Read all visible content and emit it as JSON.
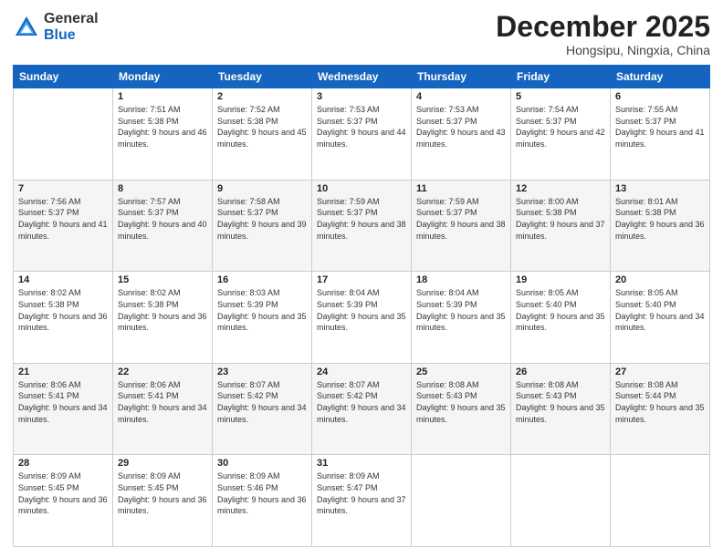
{
  "logo": {
    "general": "General",
    "blue": "Blue"
  },
  "header": {
    "month": "December 2025",
    "location": "Hongsipu, Ningxia, China"
  },
  "weekdays": [
    "Sunday",
    "Monday",
    "Tuesday",
    "Wednesday",
    "Thursday",
    "Friday",
    "Saturday"
  ],
  "weeks": [
    [
      {
        "day": "",
        "sunrise": "",
        "sunset": "",
        "daylight": ""
      },
      {
        "day": "1",
        "sunrise": "Sunrise: 7:51 AM",
        "sunset": "Sunset: 5:38 PM",
        "daylight": "Daylight: 9 hours and 46 minutes."
      },
      {
        "day": "2",
        "sunrise": "Sunrise: 7:52 AM",
        "sunset": "Sunset: 5:38 PM",
        "daylight": "Daylight: 9 hours and 45 minutes."
      },
      {
        "day": "3",
        "sunrise": "Sunrise: 7:53 AM",
        "sunset": "Sunset: 5:37 PM",
        "daylight": "Daylight: 9 hours and 44 minutes."
      },
      {
        "day": "4",
        "sunrise": "Sunrise: 7:53 AM",
        "sunset": "Sunset: 5:37 PM",
        "daylight": "Daylight: 9 hours and 43 minutes."
      },
      {
        "day": "5",
        "sunrise": "Sunrise: 7:54 AM",
        "sunset": "Sunset: 5:37 PM",
        "daylight": "Daylight: 9 hours and 42 minutes."
      },
      {
        "day": "6",
        "sunrise": "Sunrise: 7:55 AM",
        "sunset": "Sunset: 5:37 PM",
        "daylight": "Daylight: 9 hours and 41 minutes."
      }
    ],
    [
      {
        "day": "7",
        "sunrise": "Sunrise: 7:56 AM",
        "sunset": "Sunset: 5:37 PM",
        "daylight": "Daylight: 9 hours and 41 minutes."
      },
      {
        "day": "8",
        "sunrise": "Sunrise: 7:57 AM",
        "sunset": "Sunset: 5:37 PM",
        "daylight": "Daylight: 9 hours and 40 minutes."
      },
      {
        "day": "9",
        "sunrise": "Sunrise: 7:58 AM",
        "sunset": "Sunset: 5:37 PM",
        "daylight": "Daylight: 9 hours and 39 minutes."
      },
      {
        "day": "10",
        "sunrise": "Sunrise: 7:59 AM",
        "sunset": "Sunset: 5:37 PM",
        "daylight": "Daylight: 9 hours and 38 minutes."
      },
      {
        "day": "11",
        "sunrise": "Sunrise: 7:59 AM",
        "sunset": "Sunset: 5:37 PM",
        "daylight": "Daylight: 9 hours and 38 minutes."
      },
      {
        "day": "12",
        "sunrise": "Sunrise: 8:00 AM",
        "sunset": "Sunset: 5:38 PM",
        "daylight": "Daylight: 9 hours and 37 minutes."
      },
      {
        "day": "13",
        "sunrise": "Sunrise: 8:01 AM",
        "sunset": "Sunset: 5:38 PM",
        "daylight": "Daylight: 9 hours and 36 minutes."
      }
    ],
    [
      {
        "day": "14",
        "sunrise": "Sunrise: 8:02 AM",
        "sunset": "Sunset: 5:38 PM",
        "daylight": "Daylight: 9 hours and 36 minutes."
      },
      {
        "day": "15",
        "sunrise": "Sunrise: 8:02 AM",
        "sunset": "Sunset: 5:38 PM",
        "daylight": "Daylight: 9 hours and 36 minutes."
      },
      {
        "day": "16",
        "sunrise": "Sunrise: 8:03 AM",
        "sunset": "Sunset: 5:39 PM",
        "daylight": "Daylight: 9 hours and 35 minutes."
      },
      {
        "day": "17",
        "sunrise": "Sunrise: 8:04 AM",
        "sunset": "Sunset: 5:39 PM",
        "daylight": "Daylight: 9 hours and 35 minutes."
      },
      {
        "day": "18",
        "sunrise": "Sunrise: 8:04 AM",
        "sunset": "Sunset: 5:39 PM",
        "daylight": "Daylight: 9 hours and 35 minutes."
      },
      {
        "day": "19",
        "sunrise": "Sunrise: 8:05 AM",
        "sunset": "Sunset: 5:40 PM",
        "daylight": "Daylight: 9 hours and 35 minutes."
      },
      {
        "day": "20",
        "sunrise": "Sunrise: 8:05 AM",
        "sunset": "Sunset: 5:40 PM",
        "daylight": "Daylight: 9 hours and 34 minutes."
      }
    ],
    [
      {
        "day": "21",
        "sunrise": "Sunrise: 8:06 AM",
        "sunset": "Sunset: 5:41 PM",
        "daylight": "Daylight: 9 hours and 34 minutes."
      },
      {
        "day": "22",
        "sunrise": "Sunrise: 8:06 AM",
        "sunset": "Sunset: 5:41 PM",
        "daylight": "Daylight: 9 hours and 34 minutes."
      },
      {
        "day": "23",
        "sunrise": "Sunrise: 8:07 AM",
        "sunset": "Sunset: 5:42 PM",
        "daylight": "Daylight: 9 hours and 34 minutes."
      },
      {
        "day": "24",
        "sunrise": "Sunrise: 8:07 AM",
        "sunset": "Sunset: 5:42 PM",
        "daylight": "Daylight: 9 hours and 34 minutes."
      },
      {
        "day": "25",
        "sunrise": "Sunrise: 8:08 AM",
        "sunset": "Sunset: 5:43 PM",
        "daylight": "Daylight: 9 hours and 35 minutes."
      },
      {
        "day": "26",
        "sunrise": "Sunrise: 8:08 AM",
        "sunset": "Sunset: 5:43 PM",
        "daylight": "Daylight: 9 hours and 35 minutes."
      },
      {
        "day": "27",
        "sunrise": "Sunrise: 8:08 AM",
        "sunset": "Sunset: 5:44 PM",
        "daylight": "Daylight: 9 hours and 35 minutes."
      }
    ],
    [
      {
        "day": "28",
        "sunrise": "Sunrise: 8:09 AM",
        "sunset": "Sunset: 5:45 PM",
        "daylight": "Daylight: 9 hours and 36 minutes."
      },
      {
        "day": "29",
        "sunrise": "Sunrise: 8:09 AM",
        "sunset": "Sunset: 5:45 PM",
        "daylight": "Daylight: 9 hours and 36 minutes."
      },
      {
        "day": "30",
        "sunrise": "Sunrise: 8:09 AM",
        "sunset": "Sunset: 5:46 PM",
        "daylight": "Daylight: 9 hours and 36 minutes."
      },
      {
        "day": "31",
        "sunrise": "Sunrise: 8:09 AM",
        "sunset": "Sunset: 5:47 PM",
        "daylight": "Daylight: 9 hours and 37 minutes."
      },
      {
        "day": "",
        "sunrise": "",
        "sunset": "",
        "daylight": ""
      },
      {
        "day": "",
        "sunrise": "",
        "sunset": "",
        "daylight": ""
      },
      {
        "day": "",
        "sunrise": "",
        "sunset": "",
        "daylight": ""
      }
    ]
  ]
}
